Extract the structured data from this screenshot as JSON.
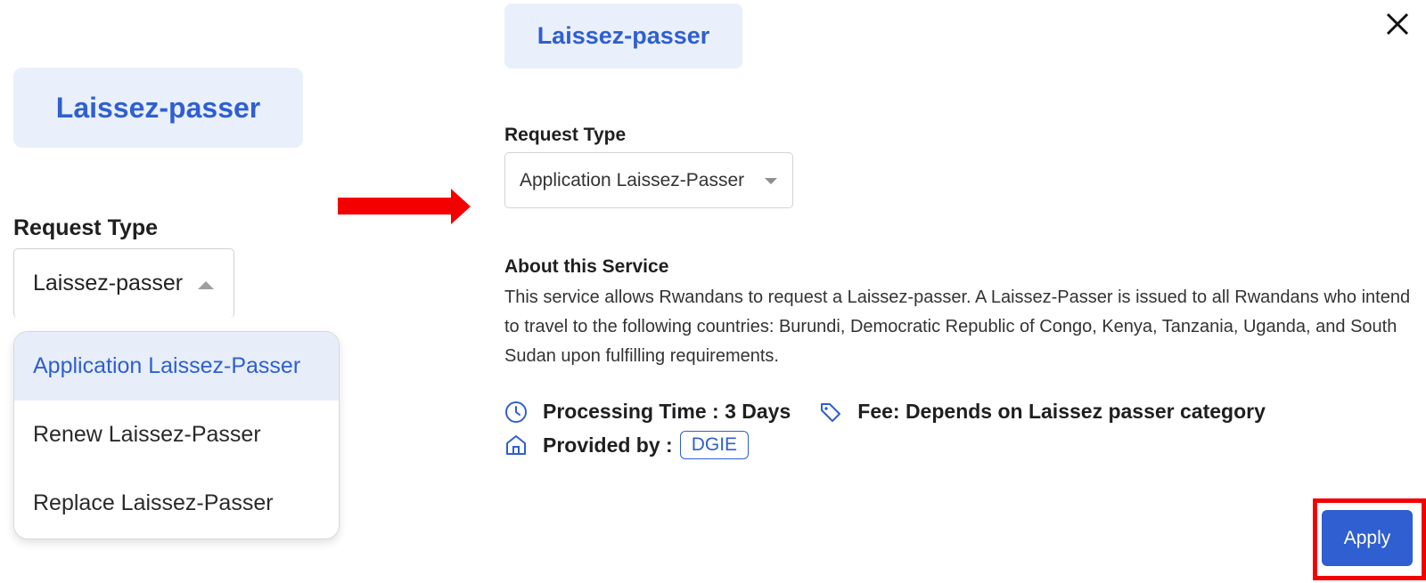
{
  "left_panel": {
    "chip_label": "Laissez-passer",
    "request_type_label": "Request Type",
    "select_value": "Laissez-passer",
    "dropdown_options": [
      "Application Laissez-Passer",
      "Renew Laissez-Passer",
      "Replace Laissez-Passer"
    ]
  },
  "right_panel": {
    "chip_label": "Laissez-passer",
    "request_type_label": "Request Type",
    "select_value": "Application Laissez-Passer",
    "about_title": "About this Service",
    "about_text": "This service allows Rwandans to request a Laissez-passer. A Laissez-Passer is issued to all Rwandans who intend to travel to the following countries: Burundi, Democratic Republic of Congo, Kenya, Tanzania, Uganda, and South Sudan upon fulfilling requirements.",
    "processing_time": "Processing Time : 3 Days",
    "fee": "Fee: Depends on Laissez passer category",
    "provided_by_label": "Provided by :",
    "provider": "DGIE",
    "apply_label": "Apply"
  },
  "icons": {
    "close": "close-icon",
    "clock": "clock-icon",
    "tag": "tag-icon",
    "home": "home-icon",
    "arrow": "arrow-right-icon"
  },
  "colors": {
    "accent": "#2f5fd0",
    "chip_bg": "#e9f0fb",
    "highlight_red": "#f40000"
  }
}
